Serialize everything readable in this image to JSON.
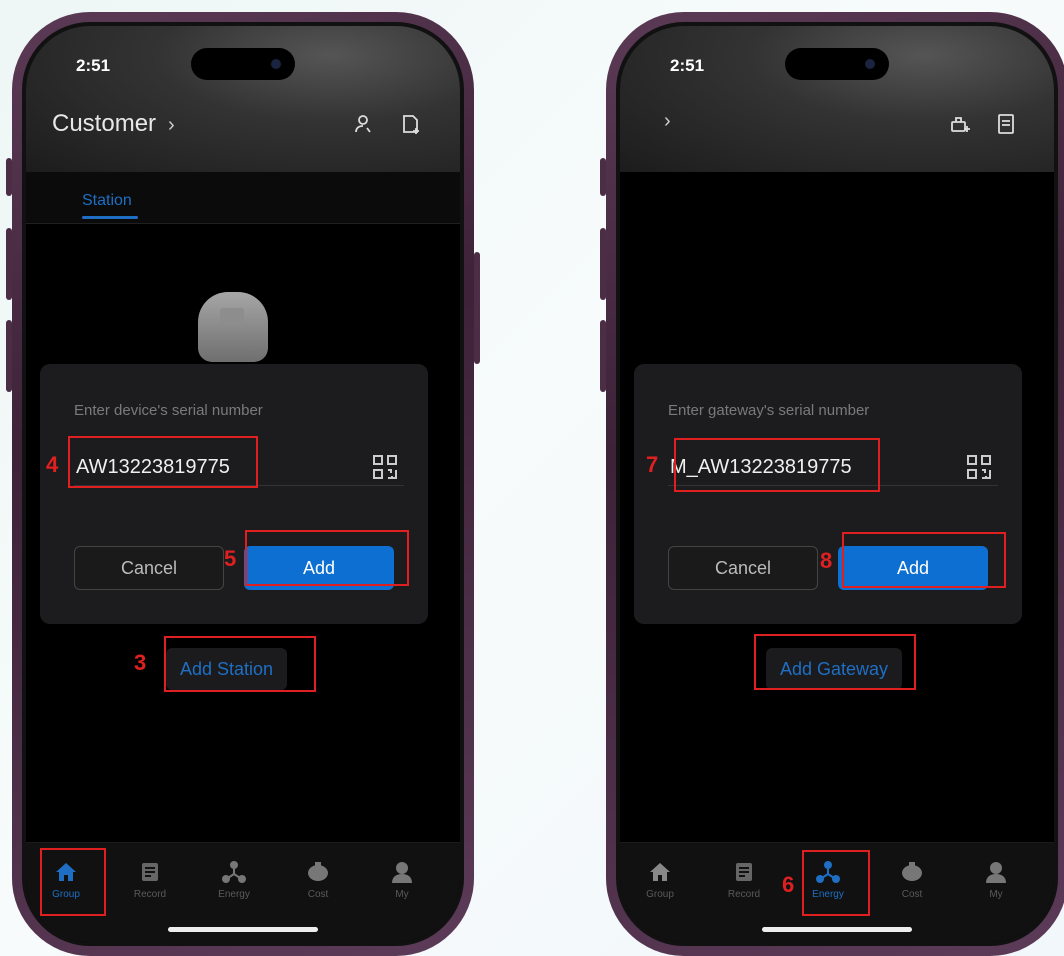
{
  "left": {
    "time": "2:51",
    "header_title": "Customer",
    "header_chevron": "›",
    "header_icons": [
      "person-icon",
      "add-contact-icon"
    ],
    "tab_label": "Station",
    "dialog": {
      "label": "Enter device's serial number",
      "serial_value": "AW13223819775",
      "cancel_label": "Cancel",
      "add_label": "Add"
    },
    "add_button_label": "Add Station",
    "step_numbers": {
      "serial": "4",
      "add": "5",
      "add_station": "3"
    },
    "nav": [
      {
        "label": "Group",
        "icon": "home-icon",
        "active": true
      },
      {
        "label": "Record",
        "icon": "record-icon",
        "active": false
      },
      {
        "label": "Energy",
        "icon": "energy-icon",
        "active": false
      },
      {
        "label": "Cost",
        "icon": "cost-icon",
        "active": false
      },
      {
        "label": "My",
        "icon": "profile-icon",
        "active": false
      }
    ]
  },
  "right": {
    "time": "2:51",
    "header_chevron": "›",
    "header_icons": [
      "add-gateway-icon",
      "list-icon"
    ],
    "dialog": {
      "label": "Enter gateway's serial number",
      "serial_value": "M_AW13223819775",
      "cancel_label": "Cancel",
      "add_label": "Add"
    },
    "add_button_label": "Add Gateway",
    "step_numbers": {
      "serial": "7",
      "add": "8",
      "energy_tab": "6"
    },
    "nav": [
      {
        "label": "Group",
        "icon": "home-icon",
        "active": false
      },
      {
        "label": "Record",
        "icon": "record-icon",
        "active": false
      },
      {
        "label": "Energy",
        "icon": "energy-icon",
        "active": true
      },
      {
        "label": "Cost",
        "icon": "cost-icon",
        "active": false
      },
      {
        "label": "My",
        "icon": "profile-icon",
        "active": false
      }
    ]
  },
  "colors": {
    "accent": "#0d6fd2",
    "highlight": "#e02020",
    "background": "#000000"
  }
}
